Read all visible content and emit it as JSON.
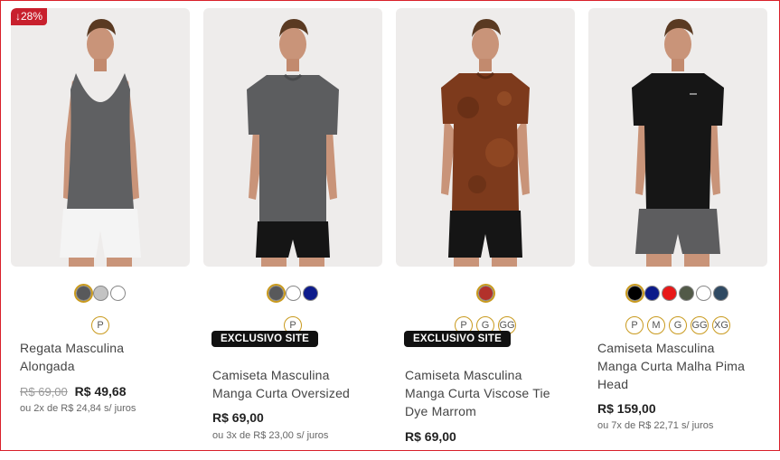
{
  "products": [
    {
      "discount_badge": "↓28%",
      "exclusive": "",
      "name": "Regata Masculina Alongada",
      "old_price": "R$ 69,00",
      "price": "R$ 49,68",
      "installments": "ou 2x de R$ 24,84 s/ juros",
      "colors": [
        "#58595b",
        "#c3c3c3",
        "#ffffff"
      ],
      "sizes": [
        "P"
      ],
      "shirt_color": "#5f6062",
      "shorts_color": "#f4f4f4",
      "shirt_type": "tank"
    },
    {
      "discount_badge": "",
      "exclusive": "EXCLUSIVO SITE",
      "name": "Camiseta Masculina Manga Curta Oversized",
      "old_price": "",
      "price": "R$ 69,00",
      "installments": "ou 3x de R$ 23,00 s/ juros",
      "colors": [
        "#58595b",
        "#ffffff",
        "#0d1b8c"
      ],
      "sizes": [
        "P"
      ],
      "shirt_color": "#5c5d5f",
      "shorts_color": "#151515",
      "shirt_type": "tee"
    },
    {
      "discount_badge": "",
      "exclusive": "EXCLUSIVO SITE",
      "name": "Camiseta Masculina Manga Curta Viscose Tie Dye Marrom",
      "old_price": "",
      "price": "R$ 69,00",
      "installments": "",
      "colors": [
        "#b2312b"
      ],
      "sizes": [
        "P",
        "G",
        "GG"
      ],
      "shirt_color": "#7d3a1c",
      "shorts_color": "#151515",
      "shirt_type": "tee"
    },
    {
      "discount_badge": "",
      "exclusive": "",
      "name": "Camiseta Masculina Manga Curta Malha Pima Head",
      "old_price": "",
      "price": "R$ 159,00",
      "installments": "ou 7x de R$ 22,71 s/ juros",
      "colors": [
        "#000000",
        "#0b1a8a",
        "#e81818",
        "#525a48",
        "#ffffff",
        "#2f4a63"
      ],
      "sizes": [
        "P",
        "M",
        "G",
        "GG",
        "XG"
      ],
      "shirt_color": "#161616",
      "shorts_color": "#5d5d5f",
      "shirt_type": "tee"
    }
  ]
}
